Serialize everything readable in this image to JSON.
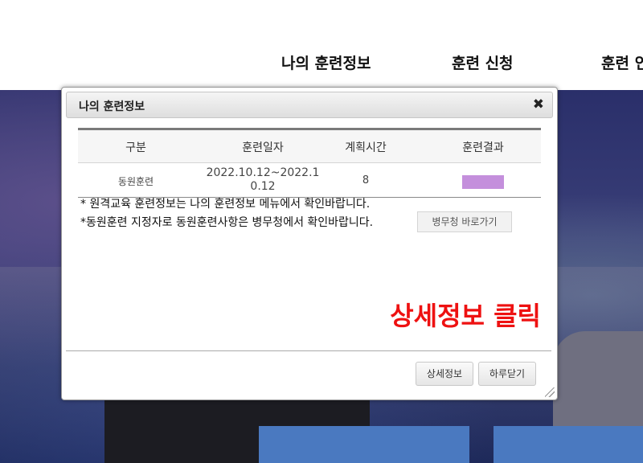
{
  "nav": {
    "items": [
      "나의 훈련정보",
      "훈련 신청",
      "훈련 인"
    ]
  },
  "modal": {
    "title": "나의 훈련정보",
    "close_symbol": "✖",
    "table": {
      "headers": [
        "구분",
        "훈련일자",
        "계획시간",
        "훈련결과"
      ],
      "rows": [
        {
          "type": "동원훈련",
          "date": "2022.10.12~2022.1\n0.12",
          "hours": "8",
          "result_color": "#c48fdc"
        }
      ]
    },
    "notice_1": "* 원격교육 훈련정보는 나의 훈련정보 메뉴에서 확인바랍니다.",
    "notice_2": "*동원훈련 지정자로 동원훈련사항은 병무청에서 확인바랍니다.",
    "mma_link_label": "병무청 바로가기",
    "callout": "상세정보 클릭",
    "detail_button": "상세정보",
    "close_today_button": "하루닫기"
  },
  "colors": {
    "callout": "#ee1111",
    "result_bar": "#c48fdc",
    "hero_card": "#4a79c0"
  }
}
